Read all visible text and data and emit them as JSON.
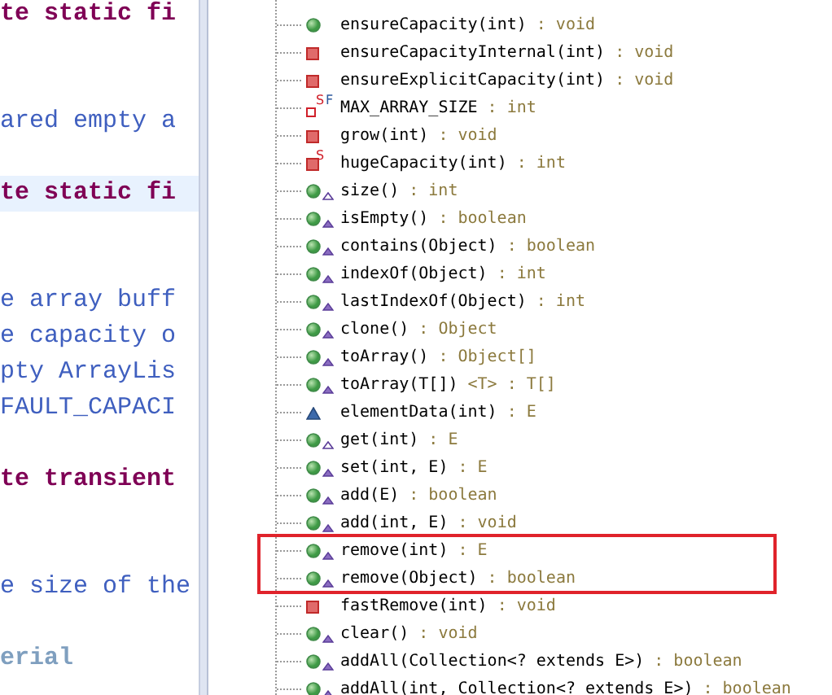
{
  "editor": {
    "lines": [
      {
        "text": "te static fi",
        "kind": "keyword",
        "current": false
      },
      {
        "kind": "blank",
        "current": false
      },
      {
        "kind": "blank",
        "current": false
      },
      {
        "text": "ared empty a",
        "kind": "comment",
        "current": false
      },
      {
        "kind": "blank",
        "current": false
      },
      {
        "text": "te static fi",
        "kind": "keyword",
        "current": true
      },
      {
        "kind": "blank",
        "current": false
      },
      {
        "kind": "blank",
        "current": false
      },
      {
        "text": "e array buff",
        "kind": "comment",
        "current": false
      },
      {
        "text": "e capacity o",
        "kind": "comment",
        "current": false
      },
      {
        "text": "pty ArrayLis",
        "kind": "comment",
        "current": false
      },
      {
        "text": "FAULT_CAPACI",
        "kind": "comment",
        "current": false
      },
      {
        "kind": "blank",
        "current": false
      },
      {
        "text": "te transient",
        "kind": "keyword",
        "current": false
      },
      {
        "kind": "blank",
        "current": false
      },
      {
        "kind": "blank",
        "current": false
      },
      {
        "text": "e size of the",
        "kind": "comment",
        "current": false
      },
      {
        "kind": "blank",
        "current": false
      },
      {
        "text": "erial",
        "kind": "tag",
        "current": false
      }
    ]
  },
  "outline": {
    "items": [
      {
        "name": "ensureCapacity(int)",
        "type": ": void",
        "kind": "public-method",
        "implements": false,
        "overrides": false,
        "boxed": false
      },
      {
        "name": "ensureCapacityInternal(int)",
        "type": ": void",
        "kind": "private-method",
        "implements": false,
        "overrides": false,
        "boxed": false
      },
      {
        "name": "ensureExplicitCapacity(int)",
        "type": ": void",
        "kind": "private-method",
        "implements": false,
        "overrides": false,
        "boxed": false
      },
      {
        "name": "MAX_ARRAY_SIZE",
        "type": ": int",
        "kind": "private-field",
        "implements": false,
        "overrides": false,
        "badges": [
          "S",
          "F"
        ],
        "boxed": false
      },
      {
        "name": "grow(int)",
        "type": ": void",
        "kind": "private-method",
        "implements": false,
        "overrides": false,
        "boxed": false
      },
      {
        "name": "hugeCapacity(int)",
        "type": ": int",
        "kind": "private-method",
        "implements": false,
        "overrides": false,
        "badges": [
          "S"
        ],
        "boxed": false
      },
      {
        "name": "size()",
        "type": ": int",
        "kind": "public-method",
        "implements": false,
        "overrides": true,
        "boxed": false
      },
      {
        "name": "isEmpty()",
        "type": ": boolean",
        "kind": "public-method",
        "implements": true,
        "overrides": false,
        "boxed": false
      },
      {
        "name": "contains(Object)",
        "type": ": boolean",
        "kind": "public-method",
        "implements": true,
        "overrides": false,
        "boxed": false
      },
      {
        "name": "indexOf(Object)",
        "type": ": int",
        "kind": "public-method",
        "implements": true,
        "overrides": false,
        "boxed": false
      },
      {
        "name": "lastIndexOf(Object)",
        "type": ": int",
        "kind": "public-method",
        "implements": true,
        "overrides": false,
        "boxed": false
      },
      {
        "name": "clone()",
        "type": ": Object",
        "kind": "public-method",
        "implements": true,
        "overrides": false,
        "boxed": false
      },
      {
        "name": "toArray()",
        "type": ": Object[]",
        "kind": "public-method",
        "implements": true,
        "overrides": false,
        "boxed": false
      },
      {
        "name": "toArray(T[])",
        "type": "<T> : T[]",
        "kind": "public-method",
        "implements": true,
        "overrides": false,
        "boxed": false
      },
      {
        "name": "elementData(int)",
        "type": ": E",
        "kind": "default-method",
        "implements": false,
        "overrides": false,
        "boxed": false
      },
      {
        "name": "get(int)",
        "type": ": E",
        "kind": "public-method",
        "implements": false,
        "overrides": true,
        "boxed": false
      },
      {
        "name": "set(int, E)",
        "type": ": E",
        "kind": "public-method",
        "implements": true,
        "overrides": false,
        "boxed": false
      },
      {
        "name": "add(E)",
        "type": ": boolean",
        "kind": "public-method",
        "implements": true,
        "overrides": false,
        "boxed": false
      },
      {
        "name": "add(int, E)",
        "type": ": void",
        "kind": "public-method",
        "implements": true,
        "overrides": false,
        "boxed": false
      },
      {
        "name": "remove(int)",
        "type": ": E",
        "kind": "public-method",
        "implements": true,
        "overrides": false,
        "boxed": true
      },
      {
        "name": "remove(Object)",
        "type": ": boolean",
        "kind": "public-method",
        "implements": true,
        "overrides": false,
        "boxed": true
      },
      {
        "name": "fastRemove(int)",
        "type": ": void",
        "kind": "private-method",
        "implements": false,
        "overrides": false,
        "boxed": false
      },
      {
        "name": "clear()",
        "type": ": void",
        "kind": "public-method",
        "implements": true,
        "overrides": false,
        "boxed": false
      },
      {
        "name": "addAll(Collection<? extends E>)",
        "type": ": boolean",
        "kind": "public-method",
        "implements": true,
        "overrides": false,
        "boxed": false
      },
      {
        "name": "addAll(int, Collection<? extends E>)",
        "type": ": boolean",
        "kind": "public-method",
        "implements": true,
        "overrides": false,
        "boxed": false
      }
    ]
  }
}
